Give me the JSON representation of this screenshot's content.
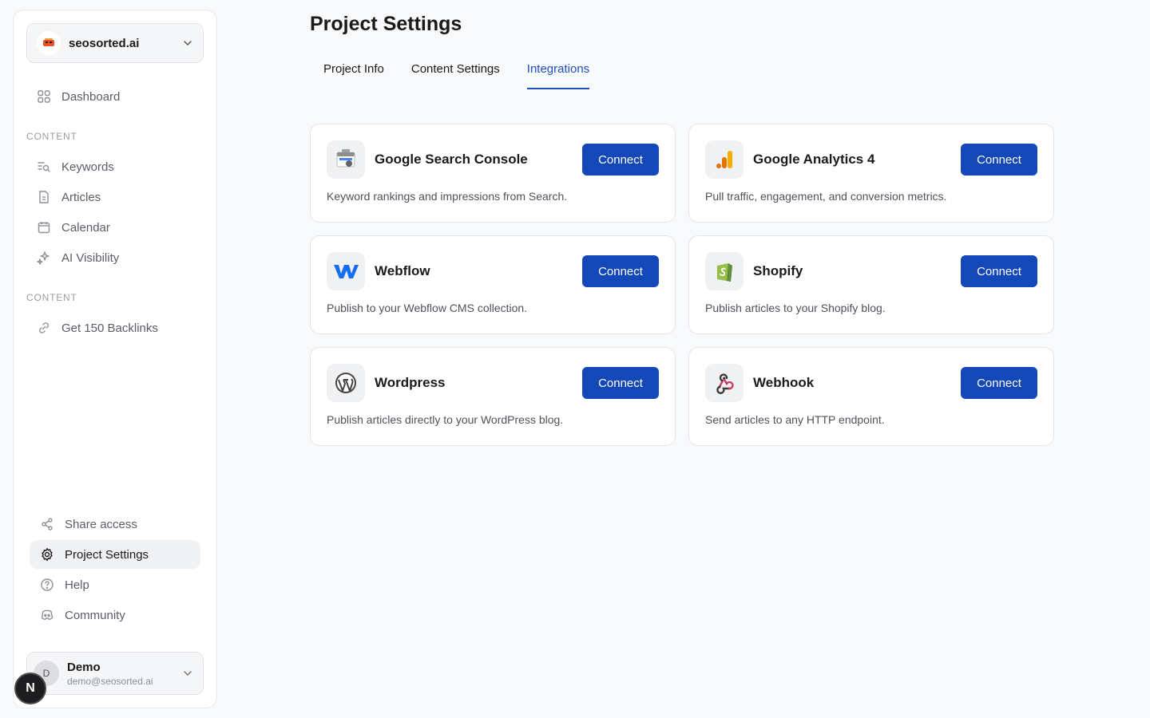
{
  "workspace": {
    "name": "seosorted.ai"
  },
  "nav": {
    "dashboard": "Dashboard",
    "section_content_1": "CONTENT",
    "keywords": "Keywords",
    "articles": "Articles",
    "calendar": "Calendar",
    "ai_visibility": "AI Visibility",
    "section_content_2": "CONTENT",
    "backlinks": "Get 150 Backlinks",
    "share_access": "Share access",
    "project_settings": "Project Settings",
    "help": "Help",
    "community": "Community"
  },
  "user": {
    "initial": "D",
    "name": "Demo",
    "email": "demo@seosorted.ai"
  },
  "badge": {
    "letter": "N"
  },
  "page": {
    "title": "Project Settings",
    "tabs": [
      "Project Info",
      "Content Settings",
      "Integrations"
    ],
    "active_tab": "Integrations"
  },
  "integrations": [
    {
      "name": "Google Search Console",
      "desc": "Keyword rankings and impressions from Search.",
      "button": "Connect",
      "icon": "google-search-console-icon"
    },
    {
      "name": "Google Analytics 4",
      "desc": "Pull traffic, engagement, and conversion metrics.",
      "button": "Connect",
      "icon": "google-analytics-icon"
    },
    {
      "name": "Webflow",
      "desc": "Publish to your Webflow CMS collection.",
      "button": "Connect",
      "icon": "webflow-icon"
    },
    {
      "name": "Shopify",
      "desc": "Publish articles to your Shopify blog.",
      "button": "Connect",
      "icon": "shopify-icon"
    },
    {
      "name": "Wordpress",
      "desc": "Publish articles directly to your WordPress blog.",
      "button": "Connect",
      "icon": "wordpress-icon"
    },
    {
      "name": "Webhook",
      "desc": "Send articles to any HTTP endpoint.",
      "button": "Connect",
      "icon": "webhook-icon"
    }
  ],
  "colors": {
    "accent": "#1447b8",
    "tab_active": "#1f4fbf"
  }
}
